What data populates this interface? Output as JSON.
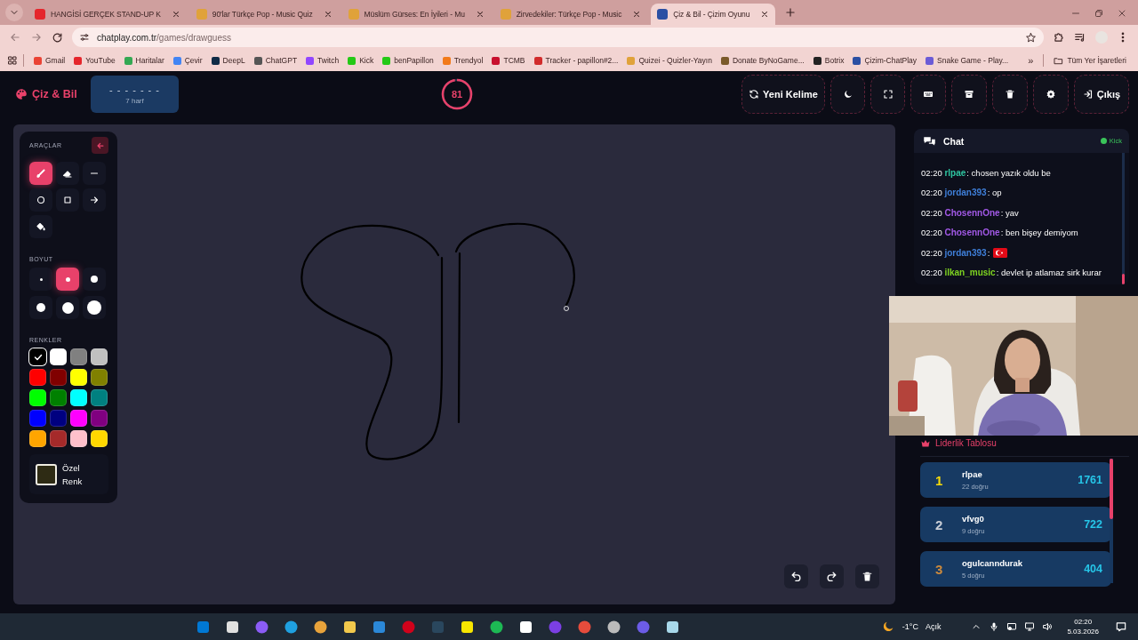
{
  "browser": {
    "tabs": [
      {
        "title": "HANGİSİ GERÇEK STAND-UP K",
        "selected": false,
        "color": "#e5262c"
      },
      {
        "title": "90'lar Türkçe Pop - Music Quiz",
        "selected": false,
        "color": "#e0a23a"
      },
      {
        "title": "Müslüm Gürses: En İyileri - Mu",
        "selected": false,
        "color": "#e0a23a"
      },
      {
        "title": "Zirvedekiler: Türkçe Pop - Music",
        "selected": false,
        "color": "#e0a23a"
      },
      {
        "title": "Çiz & Bil - Çizim Oyunu",
        "selected": true,
        "color": "#2b4fa3"
      }
    ],
    "url": {
      "host": "chatplay.com.tr",
      "path": "/games/drawguess"
    },
    "bookmarks": [
      {
        "label": "Gmail",
        "color": "#ea4335"
      },
      {
        "label": "YouTube",
        "color": "#e5262c"
      },
      {
        "label": "Haritalar",
        "color": "#34a853"
      },
      {
        "label": "Çevir",
        "color": "#4285f4"
      },
      {
        "label": "DeepL",
        "color": "#0f2b46"
      },
      {
        "label": "ChatGPT",
        "color": "#555555"
      },
      {
        "label": "Twitch",
        "color": "#9146ff"
      },
      {
        "label": "Kick",
        "color": "#24c916"
      },
      {
        "label": "benPapillon",
        "color": "#24c916"
      },
      {
        "label": "Trendyol",
        "color": "#f27a1a"
      },
      {
        "label": "TCMB",
        "color": "#c8102e"
      },
      {
        "label": "Tracker - papillon#2...",
        "color": "#d12b2b"
      },
      {
        "label": "Quizei - Quizler-Yayın",
        "color": "#e0a23a"
      },
      {
        "label": "Donate ByNoGame...",
        "color": "#7a5a2a"
      },
      {
        "label": "Botrix",
        "color": "#222222"
      },
      {
        "label": "Çizim-ChatPlay",
        "color": "#2b4fa3"
      },
      {
        "label": "Snake Game - Play...",
        "color": "#6b5bd6"
      }
    ],
    "more": "»",
    "all_bookmarks": "Tüm Yer İşaretleri"
  },
  "header": {
    "logo": "Çiz & Bil",
    "word_mask": "- - - - - - -",
    "word_length": "7 harf",
    "timer": {
      "value": "81",
      "level": 0.97
    },
    "buttons": [
      {
        "kind": "refresh",
        "label": "Yeni Kelime"
      },
      {
        "kind": "moon"
      },
      {
        "kind": "expand"
      },
      {
        "kind": "keyboard"
      },
      {
        "kind": "archive"
      },
      {
        "kind": "trash"
      },
      {
        "kind": "gear"
      },
      {
        "kind": "logout",
        "label": "Çıkış"
      }
    ]
  },
  "tools": {
    "heading": "ARAÇLAR",
    "items": [
      {
        "kind": "pen",
        "selected": true
      },
      {
        "kind": "eraser",
        "selected": false
      },
      {
        "kind": "line",
        "selected": false
      },
      {
        "kind": "circle",
        "selected": false
      },
      {
        "kind": "square",
        "selected": false
      },
      {
        "kind": "arrow",
        "selected": false
      },
      {
        "kind": "bucket",
        "selected": false
      }
    ]
  },
  "sizes": {
    "heading": "BOYUT",
    "items": [
      {
        "selected": false
      },
      {
        "selected": true
      },
      {
        "selected": false
      },
      {
        "selected": false
      },
      {
        "selected": false
      },
      {
        "selected": false
      }
    ]
  },
  "colors": {
    "heading": "RENKLER",
    "swatches": [
      {
        "color": "#000000",
        "selected": true
      },
      {
        "color": "#ffffff",
        "selected": false
      },
      {
        "color": "#808080",
        "selected": false
      },
      {
        "color": "#c0c0c0",
        "selected": false
      },
      {
        "color": "#ff0000",
        "selected": false
      },
      {
        "color": "#800000",
        "selected": false
      },
      {
        "color": "#ffff00",
        "selected": false
      },
      {
        "color": "#808000",
        "selected": false
      },
      {
        "color": "#00ff00",
        "selected": false
      },
      {
        "color": "#008000",
        "selected": false
      },
      {
        "color": "#00ffff",
        "selected": false
      },
      {
        "color": "#008080",
        "selected": false
      },
      {
        "color": "#0000ff",
        "selected": false
      },
      {
        "color": "#000080",
        "selected": false
      },
      {
        "color": "#ff00ff",
        "selected": false
      },
      {
        "color": "#800080",
        "selected": false
      },
      {
        "color": "#ffa500",
        "selected": false
      },
      {
        "color": "#a52a2a",
        "selected": false
      },
      {
        "color": "#ffc0cb",
        "selected": false
      },
      {
        "color": "#ffd700",
        "selected": false
      }
    ],
    "custom": {
      "label": "Özel Renk",
      "color": "#2e2b14"
    }
  },
  "chat": {
    "title": "Chat",
    "source": "Kick",
    "messages": [
      {
        "kind": "text",
        "time": "02:20",
        "user": "rlpae",
        "color": "#2ec4a0",
        "text": ": chosen yazık oldu be"
      },
      {
        "kind": "text",
        "time": "02:20",
        "user": "jordan393",
        "color": "#3f7fd9",
        "text": ": op"
      },
      {
        "kind": "text",
        "time": "02:20",
        "user": "ChosennOne",
        "color": "#a259e6",
        "text": ": yav"
      },
      {
        "kind": "text",
        "time": "02:20",
        "user": "ChosennOne",
        "color": "#a259e6",
        "text": ": ben bişey demiyom"
      },
      {
        "kind": "emote",
        "time": "02:20",
        "user": "jordan393",
        "color": "#3f7fd9",
        "text": ": "
      },
      {
        "kind": "text",
        "time": "02:20",
        "user": "ilkan_music",
        "color": "#7ed321",
        "text": ": devlet ip atlamaz sirk kurar"
      }
    ]
  },
  "leaderboard": {
    "title": "Liderlik Tablosu",
    "entries": [
      {
        "rank": "1",
        "name": "rlpae",
        "correct": "22 doğru",
        "score": "1761",
        "color": "#f5d90a"
      },
      {
        "rank": "2",
        "name": "vfvg0",
        "correct": "9 doğru",
        "score": "722",
        "color": "#c9ced6"
      },
      {
        "rank": "3",
        "name": "ogulcanndurak",
        "correct": "5 doğru",
        "score": "404",
        "color": "#cd8a3c"
      }
    ]
  },
  "taskbar": {
    "temperature": "-1°C",
    "weather": "Açık",
    "time": "02:20",
    "date": "5.03.2026"
  }
}
